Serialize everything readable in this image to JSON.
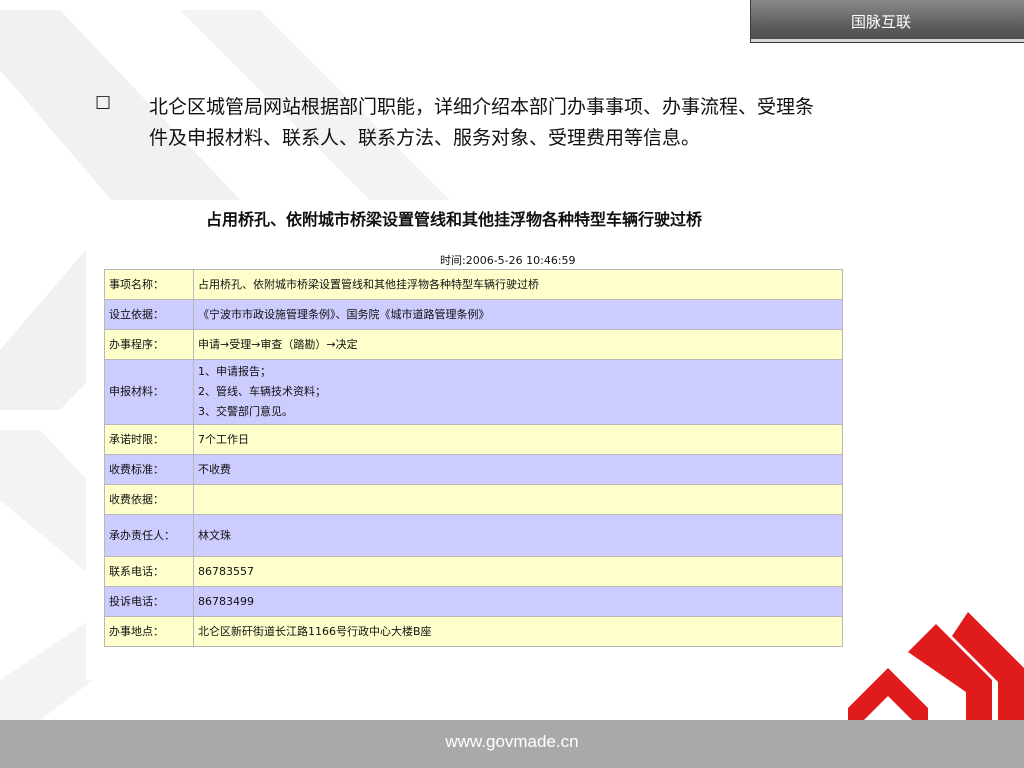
{
  "brand": {
    "name": "国脉互联"
  },
  "bullet": {
    "icon": "checkbox-icon",
    "text": "北仑区城管局网站根据部门职能，详细介绍本部门办事事项、办事流程、受理条件及申报材料、联系人、联系方法、服务对象、受理费用等信息。"
  },
  "document": {
    "title": "占用桥孔、依附城市桥梁设置管线和其他挂浮物各种特型车辆行驶过桥",
    "time": "时间:2006-5-26 10:46:59",
    "rows": [
      {
        "label": "事项名称：",
        "lines": [
          "占用桥孔、依附城市桥梁设置管线和其他挂浮物各种特型车辆行驶过桥"
        ]
      },
      {
        "label": "设立依据：",
        "lines": [
          "《宁波市市政设施管理条例》、国务院《城市道路管理条例》"
        ]
      },
      {
        "label": "办事程序：",
        "lines": [
          "申请→受理→审查（踏勘）→决定"
        ]
      },
      {
        "label": "申报材料：",
        "lines": [
          "1、申请报告；",
          "2、管线、车辆技术资料；",
          "3、交警部门意见。"
        ]
      },
      {
        "label": "承诺时限：",
        "lines": [
          "7个工作日"
        ]
      },
      {
        "label": "收费标准：",
        "lines": [
          "不收费"
        ]
      },
      {
        "label": "收费依据：",
        "lines": [
          ""
        ]
      },
      {
        "label": "承办责任人：",
        "lines": [
          "林文珠"
        ]
      },
      {
        "label": "联系电话：",
        "lines": [
          "86783557"
        ]
      },
      {
        "label": "投诉电话：",
        "lines": [
          "86783499"
        ]
      },
      {
        "label": "办事地点：",
        "lines": [
          "北仑区新矸街道长江路1166号行政中心大楼B座"
        ]
      }
    ]
  },
  "footer": {
    "url": "www.govmade.cn"
  },
  "colors": {
    "row_yellow": "#ffffcc",
    "row_blue": "#ccccff",
    "logo_red": "#e01b1b",
    "footer_gray": "#a9a9a9"
  }
}
